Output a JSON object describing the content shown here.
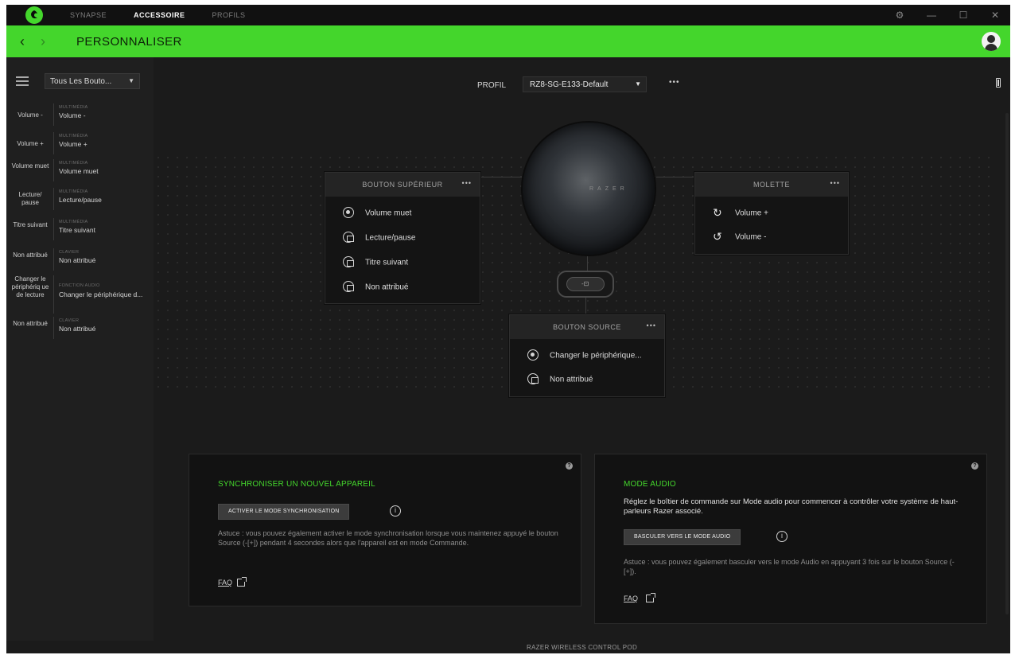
{
  "titlebar": {
    "tabs": [
      {
        "label": "SYNAPSE"
      },
      {
        "label": "ACCESSOIRE"
      },
      {
        "label": "PROFILS"
      }
    ]
  },
  "header": {
    "title": "PERSONNALISER"
  },
  "sidebar": {
    "filter": "Tous Les Bouto...",
    "mappings": [
      {
        "button": "Volume -",
        "category": "MULTIMÉDIA",
        "action": "Volume -"
      },
      {
        "button": "Volume +",
        "category": "MULTIMÉDIA",
        "action": "Volume +"
      },
      {
        "button": "Volume muet",
        "category": "MULTIMÉDIA",
        "action": "Volume muet"
      },
      {
        "button": "Lecture/ pause",
        "category": "MULTIMÉDIA",
        "action": "Lecture/pause"
      },
      {
        "button": "Titre suivant",
        "category": "MULTIMÉDIA",
        "action": "Titre suivant"
      },
      {
        "button": "Non attribué",
        "category": "CLAVIER",
        "action": "Non attribué"
      },
      {
        "button": "Changer le périphériq ue de lecture",
        "category": "FONCTION AUDIO",
        "action": "Changer le périphérique d..."
      },
      {
        "button": "Non attribué",
        "category": "CLAVIER",
        "action": "Non attribué"
      }
    ]
  },
  "profile": {
    "label": "PROFIL",
    "value": "RZ8-SG-E133-Default",
    "more": "•••"
  },
  "device": {
    "brand": "RAZER"
  },
  "cards": {
    "top_button": {
      "title": "BOUTON SUPÉRIEUR",
      "more": "•••",
      "rows": [
        "Volume muet",
        "Lecture/pause",
        "Titre suivant",
        "Non attribué"
      ]
    },
    "wheel": {
      "title": "MOLETTE",
      "more": "•••",
      "rows": [
        "Volume +",
        "Volume -"
      ]
    },
    "source": {
      "title": "BOUTON SOURCE",
      "more": "•••",
      "rows": [
        "Changer le périphérique...",
        "Non attribué"
      ]
    }
  },
  "sync_panel": {
    "title": "SYNCHRONISER UN NOUVEL APPAREIL",
    "button": "ACTIVER LE MODE SYNCHRONISATION",
    "tip": "Astuce : vous pouvez également activer le mode synchronisation lorsque vous maintenez appuyé le bouton Source (-[+]) pendant 4 secondes alors que l'appareil est en mode Commande.",
    "faq": "FAQ"
  },
  "audio_panel": {
    "title": "MODE AUDIO",
    "description": "Réglez le boîtier de commande sur Mode audio pour commencer à contrôler votre système de haut-parleurs Razer associé.",
    "button": "BASCULER VERS LE MODE AUDIO",
    "tip": "Astuce : vous pouvez également basculer vers le mode Audio en appuyant 3 fois sur le bouton Source (-[+]).",
    "faq": "FAQ"
  },
  "footer": {
    "device_name": "RAZER WIRELESS CONTROL POD"
  },
  "colors": {
    "accent": "#44d62c",
    "background": "#1b1b1b",
    "card": "#141414"
  }
}
